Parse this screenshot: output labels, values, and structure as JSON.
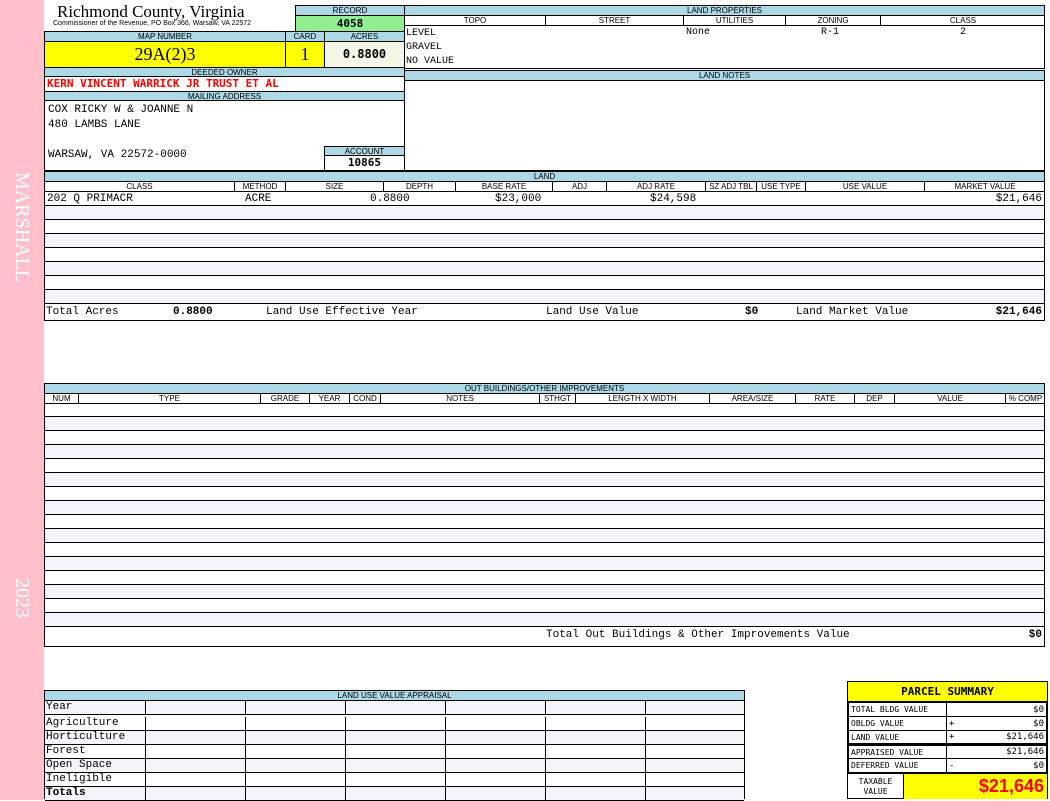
{
  "sidebar": {
    "name": "MARSHALL",
    "year": "2023"
  },
  "header": {
    "title": "Richmond County, Virginia",
    "subtitle": "Commissioner of the Revenue, PO Box 366, Warsaw, VA 22572"
  },
  "record": {
    "label": "RECORD",
    "value": "4058"
  },
  "map": {
    "label": "MAP NUMBER",
    "value": "29A(2)3"
  },
  "card": {
    "label": "CARD",
    "value": "1"
  },
  "acres": {
    "label": "ACRES",
    "value": "0.8800"
  },
  "owner": {
    "label": "DEEDED OWNER",
    "value": "KERN VINCENT WARRICK JR TRUST ET AL"
  },
  "mailing": {
    "label": "MAILING ADDRESS",
    "line1": "COX RICKY W & JOANNE N",
    "line2": "480 LAMBS LANE",
    "line3": "WARSAW, VA 22572-0000"
  },
  "account": {
    "label": "ACCOUNT",
    "value": "10865"
  },
  "land_properties": {
    "label": "LAND PROPERTIES",
    "headers": [
      "TOPO",
      "STREET",
      "UTILITIES",
      "ZONING",
      "CLASS"
    ],
    "topo": [
      "LEVEL",
      "GRAVEL",
      "NO VALUE"
    ],
    "utilities": "None",
    "zoning": "R-1",
    "class": "2"
  },
  "land_notes": {
    "label": "LAND NOTES"
  },
  "land": {
    "label": "LAND",
    "headers": [
      "CLASS",
      "METHOD",
      "SIZE",
      "DEPTH",
      "BASE RATE",
      "ADJ",
      "ADJ RATE",
      "SZ ADJ TBL",
      "USE TYPE",
      "USE VALUE",
      "MARKET VALUE"
    ],
    "row": {
      "class": "202 Q PRIMACR",
      "method": "ACRE",
      "size": "0.8800",
      "base_rate": "$23,000",
      "adj_rate": "$24,598",
      "market_value": "$21,646"
    },
    "totals": {
      "acres_label": "Total Acres",
      "acres": "0.8800",
      "effective_year_label": "Land Use Effective Year",
      "use_value_label": "Land Use Value",
      "use_value": "$0",
      "market_label": "Land Market Value",
      "market": "$21,646"
    }
  },
  "outbuildings": {
    "label": "OUT BUILDINGS/OTHER IMPROVEMENTS",
    "headers": [
      "NUM",
      "TYPE",
      "GRADE",
      "YEAR",
      "COND",
      "NOTES",
      "STHGT",
      "LENGTH X WIDTH",
      "AREA/SIZE",
      "RATE",
      "DEP",
      "VALUE",
      "% COMP"
    ],
    "total_label": "Total Out Buildings & Other Improvements Value",
    "total": "$0"
  },
  "land_use": {
    "label": "LAND USE VALUE APPRAISAL",
    "year_label": "Year",
    "rows": [
      "Agriculture",
      "Horticulture",
      "Forest",
      "Open Space",
      "Ineligible"
    ],
    "totals_label": "Totals"
  },
  "parcel_summary": {
    "title": "PARCEL SUMMARY",
    "rows": [
      {
        "label": "TOTAL BLDG VALUE",
        "op": "",
        "value": "$0"
      },
      {
        "label": "OBLDG VALUE",
        "op": "+",
        "value": "$0"
      },
      {
        "label": "LAND VALUE",
        "op": "+",
        "value": "$21,646"
      },
      {
        "label": "APPRAISED VALUE",
        "op": "",
        "value": "$21,646"
      },
      {
        "label": "DEFERRED VALUE",
        "op": "-",
        "value": "$0"
      }
    ],
    "taxable_label": "TAXABLE VALUE",
    "taxable": "$21,646"
  },
  "colors": {
    "sidebar": "#ffc0cb",
    "label_bg": "#add8e6",
    "record_bg": "#90ee90",
    "highlight": "#ffff00",
    "owner_text": "#ff0000"
  }
}
